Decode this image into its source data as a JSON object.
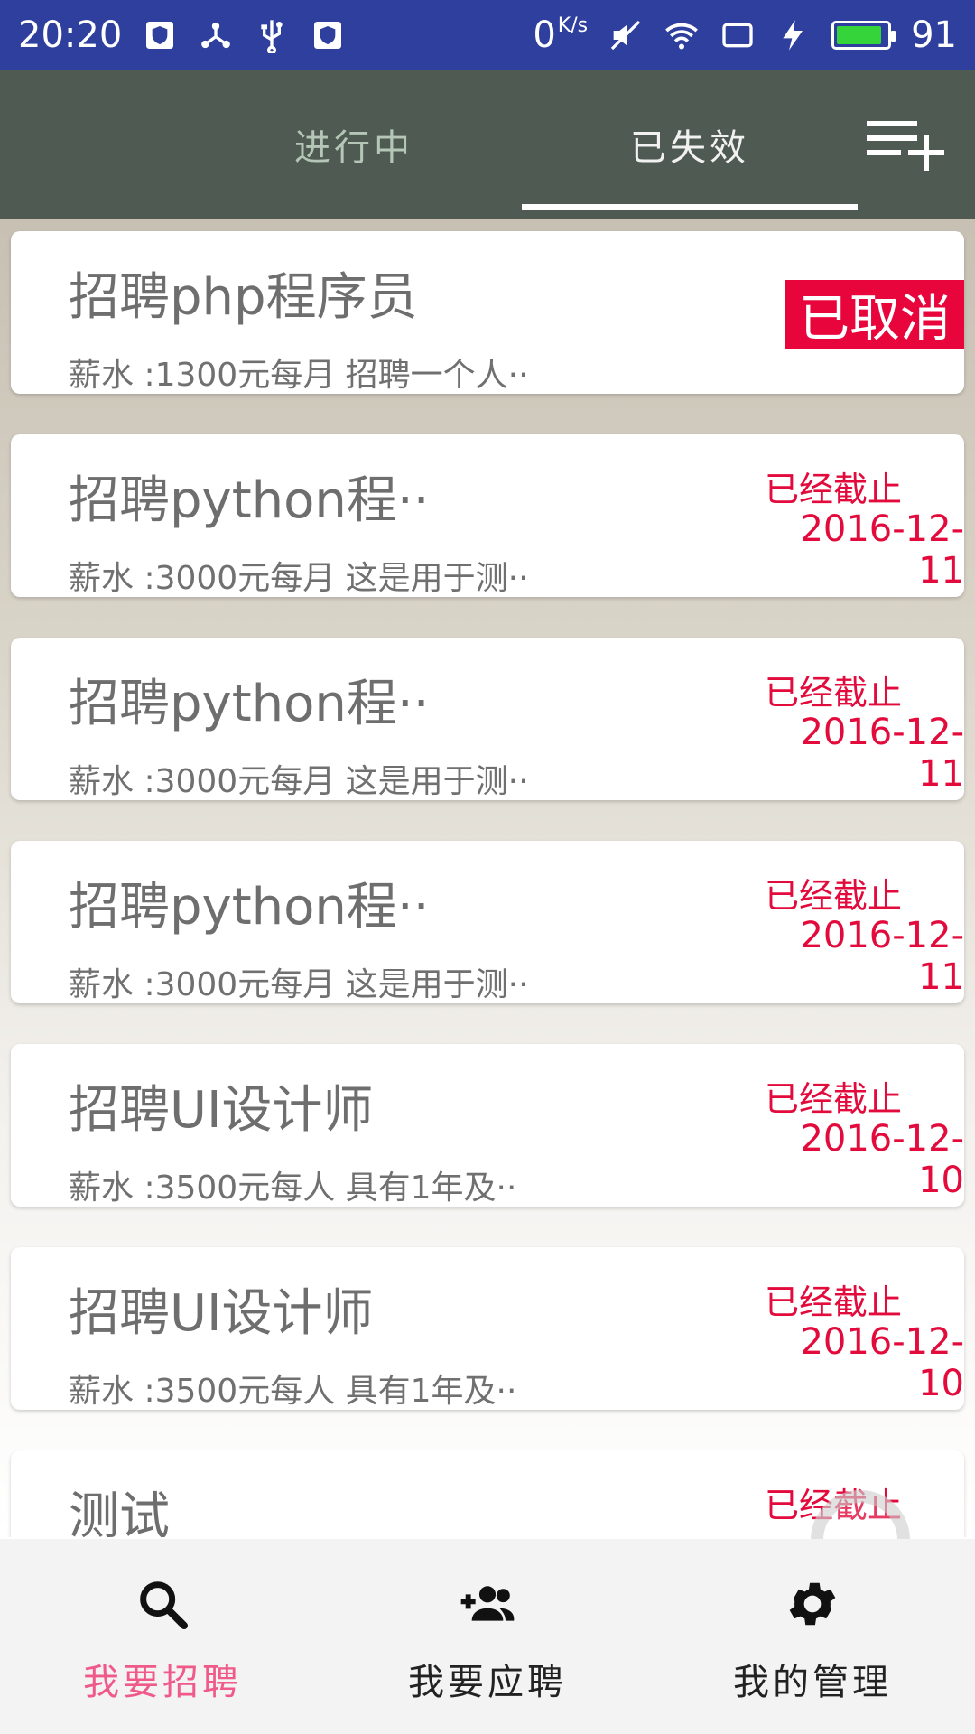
{
  "status_bar": {
    "time": "20:20",
    "net_speed": "0",
    "net_unit": "K/s",
    "battery": "91",
    "battery_level_percent": 91
  },
  "tabs": [
    {
      "label": "进行中",
      "active": false
    },
    {
      "label": "已失效",
      "active": true
    }
  ],
  "header_action_icon": "playlist-add-icon",
  "jobs": [
    {
      "title": "招聘php程序员",
      "subtitle": "薪水 :1300元每月  招聘一个人··",
      "status": "已取消",
      "date": ""
    },
    {
      "title": "招聘python程··",
      "subtitle": "薪水 :3000元每月  这是用于测··",
      "status": "已经截止",
      "date": "2016-12-11"
    },
    {
      "title": "招聘python程··",
      "subtitle": "薪水 :3000元每月  这是用于测··",
      "status": "已经截止",
      "date": "2016-12-11"
    },
    {
      "title": "招聘python程··",
      "subtitle": "薪水 :3000元每月  这是用于测··",
      "status": "已经截止",
      "date": "2016-12-11"
    },
    {
      "title": "招聘UI设计师",
      "subtitle": "薪水 :3500元每人  具有1年及··",
      "status": "已经截止",
      "date": "2016-12-10"
    },
    {
      "title": "招聘UI设计师",
      "subtitle": "薪水 :3500元每人  具有1年及··",
      "status": "已经截止",
      "date": "2016-12-10"
    },
    {
      "title": "测试",
      "subtitle": "",
      "status": "已经截止",
      "date": ""
    }
  ],
  "bottom_nav": [
    {
      "label": "我要招聘",
      "icon": "search-icon",
      "active": true
    },
    {
      "label": "我要应聘",
      "icon": "add-group-icon",
      "active": false
    },
    {
      "label": "我的管理",
      "icon": "gear-icon",
      "active": false
    }
  ],
  "colors": {
    "status_bar": "#2e3f9e",
    "tab_bar": "#4f5a52",
    "accent_red": "#e20b3c",
    "nav_active": "#f05a8a"
  }
}
